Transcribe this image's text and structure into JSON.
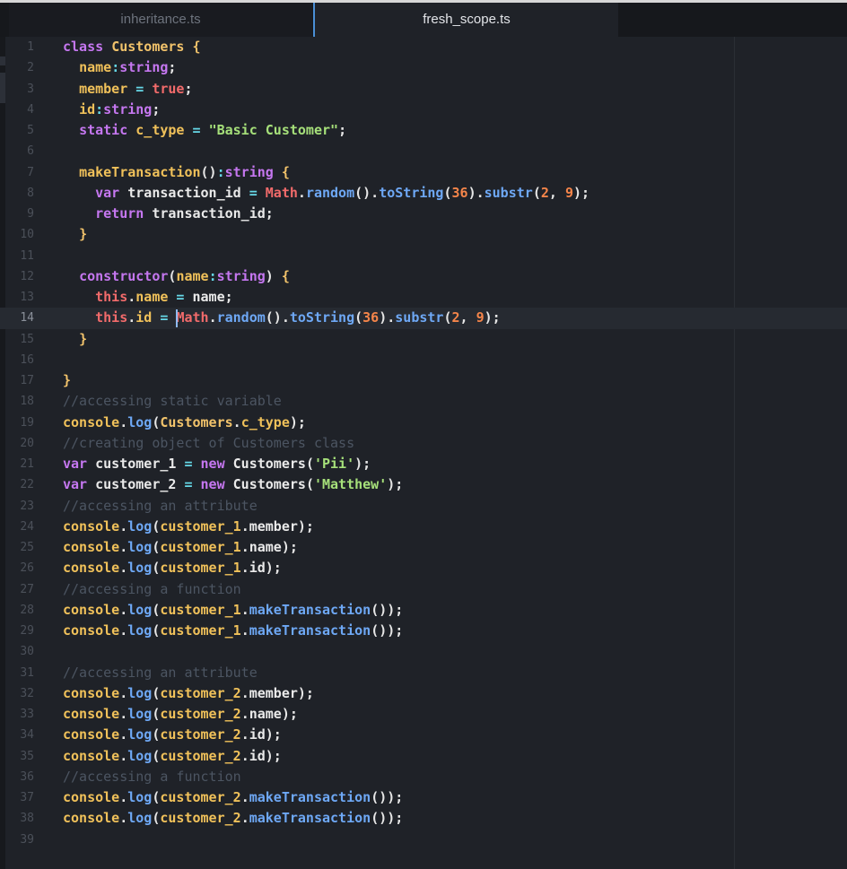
{
  "tabs": [
    {
      "label": "inheritance.ts",
      "active": false
    },
    {
      "label": "fresh_scope.ts",
      "active": true
    }
  ],
  "editor": {
    "current_line": 14,
    "lines": [
      {
        "n": "1",
        "tokens": [
          [
            "kw",
            "class "
          ],
          [
            "cls",
            "Customers "
          ],
          [
            "brace",
            "{"
          ]
        ]
      },
      {
        "n": "2",
        "tokens": [
          [
            "p",
            "  "
          ],
          [
            "prop",
            "name"
          ],
          [
            "op",
            ":"
          ],
          [
            "type",
            "string"
          ],
          [
            "p",
            ";"
          ]
        ]
      },
      {
        "n": "3",
        "tokens": [
          [
            "p",
            "  "
          ],
          [
            "prop",
            "member"
          ],
          [
            "op",
            " = "
          ],
          [
            "bool",
            "true"
          ],
          [
            "p",
            ";"
          ]
        ]
      },
      {
        "n": "4",
        "tokens": [
          [
            "p",
            "  "
          ],
          [
            "prop",
            "id"
          ],
          [
            "op",
            ":"
          ],
          [
            "type",
            "string"
          ],
          [
            "p",
            ";"
          ]
        ]
      },
      {
        "n": "5",
        "tokens": [
          [
            "p",
            "  "
          ],
          [
            "kw",
            "static "
          ],
          [
            "prop",
            "c_type"
          ],
          [
            "op",
            " = "
          ],
          [
            "str",
            "\"Basic Customer\""
          ],
          [
            "p",
            ";"
          ]
        ]
      },
      {
        "n": "6",
        "tokens": []
      },
      {
        "n": "7",
        "tokens": [
          [
            "p",
            "  "
          ],
          [
            "prop",
            "makeTransaction"
          ],
          [
            "p",
            "()"
          ],
          [
            "op",
            ":"
          ],
          [
            "type",
            "string"
          ],
          [
            "p",
            " "
          ],
          [
            "brace",
            "{"
          ]
        ]
      },
      {
        "n": "8",
        "tokens": [
          [
            "p",
            "    "
          ],
          [
            "kw",
            "var "
          ],
          [
            "id",
            "transaction_id"
          ],
          [
            "op",
            " = "
          ],
          [
            "this",
            "Math"
          ],
          [
            "p",
            "."
          ],
          [
            "fn",
            "random"
          ],
          [
            "p",
            "()."
          ],
          [
            "fn",
            "toString"
          ],
          [
            "p",
            "("
          ],
          [
            "num",
            "36"
          ],
          [
            "p",
            ")."
          ],
          [
            "fn",
            "substr"
          ],
          [
            "p",
            "("
          ],
          [
            "num",
            "2"
          ],
          [
            "p",
            ", "
          ],
          [
            "num",
            "9"
          ],
          [
            "p",
            ");"
          ]
        ]
      },
      {
        "n": "9",
        "tokens": [
          [
            "p",
            "    "
          ],
          [
            "kw",
            "return "
          ],
          [
            "id",
            "transaction_id"
          ],
          [
            "p",
            ";"
          ]
        ]
      },
      {
        "n": "10",
        "tokens": [
          [
            "p",
            "  "
          ],
          [
            "brace",
            "}"
          ]
        ]
      },
      {
        "n": "11",
        "tokens": []
      },
      {
        "n": "12",
        "tokens": [
          [
            "p",
            "  "
          ],
          [
            "kw",
            "constructor"
          ],
          [
            "p",
            "("
          ],
          [
            "prop",
            "name"
          ],
          [
            "op",
            ":"
          ],
          [
            "type",
            "string"
          ],
          [
            "p",
            ") "
          ],
          [
            "brace",
            "{"
          ]
        ]
      },
      {
        "n": "13",
        "tokens": [
          [
            "p",
            "    "
          ],
          [
            "this",
            "this"
          ],
          [
            "p",
            "."
          ],
          [
            "prop",
            "name"
          ],
          [
            "op",
            " = "
          ],
          [
            "id",
            "name"
          ],
          [
            "p",
            ";"
          ]
        ]
      },
      {
        "n": "14",
        "tokens": [
          [
            "p",
            "    "
          ],
          [
            "this",
            "this"
          ],
          [
            "p",
            "."
          ],
          [
            "prop",
            "id"
          ],
          [
            "op",
            " = "
          ],
          [
            "this",
            "Math"
          ],
          [
            "p",
            "."
          ],
          [
            "fn",
            "random"
          ],
          [
            "p",
            "()."
          ],
          [
            "fn",
            "toString"
          ],
          [
            "p",
            "("
          ],
          [
            "num",
            "36"
          ],
          [
            "p",
            ")."
          ],
          [
            "fn",
            "substr"
          ],
          [
            "p",
            "("
          ],
          [
            "num",
            "2"
          ],
          [
            "p",
            ", "
          ],
          [
            "num",
            "9"
          ],
          [
            "p",
            ");"
          ]
        ]
      },
      {
        "n": "15",
        "tokens": [
          [
            "p",
            "  "
          ],
          [
            "brace",
            "}"
          ]
        ]
      },
      {
        "n": "16",
        "tokens": []
      },
      {
        "n": "17",
        "tokens": [
          [
            "brace",
            "}"
          ]
        ]
      },
      {
        "n": "18",
        "tokens": [
          [
            "cm",
            "//accessing static variable"
          ]
        ]
      },
      {
        "n": "19",
        "tokens": [
          [
            "prop",
            "console"
          ],
          [
            "p",
            "."
          ],
          [
            "fn",
            "log"
          ],
          [
            "p",
            "("
          ],
          [
            "cls",
            "Customers"
          ],
          [
            "p",
            "."
          ],
          [
            "prop",
            "c_type"
          ],
          [
            "p",
            ");"
          ]
        ]
      },
      {
        "n": "20",
        "tokens": [
          [
            "cm",
            "//creating object of Customers class"
          ]
        ]
      },
      {
        "n": "21",
        "tokens": [
          [
            "kw",
            "var "
          ],
          [
            "id",
            "customer_1"
          ],
          [
            "op",
            " = "
          ],
          [
            "kw",
            "new "
          ],
          [
            "id",
            "Customers"
          ],
          [
            "p",
            "("
          ],
          [
            "str",
            "'Pii'"
          ],
          [
            "p",
            ");"
          ]
        ]
      },
      {
        "n": "22",
        "tokens": [
          [
            "kw",
            "var "
          ],
          [
            "id",
            "customer_2"
          ],
          [
            "op",
            " = "
          ],
          [
            "kw",
            "new "
          ],
          [
            "id",
            "Customers"
          ],
          [
            "p",
            "("
          ],
          [
            "str",
            "'Matthew'"
          ],
          [
            "p",
            ");"
          ]
        ]
      },
      {
        "n": "23",
        "tokens": [
          [
            "cm",
            "//accessing an attribute"
          ]
        ]
      },
      {
        "n": "24",
        "tokens": [
          [
            "prop",
            "console"
          ],
          [
            "p",
            "."
          ],
          [
            "fn",
            "log"
          ],
          [
            "p",
            "("
          ],
          [
            "prop",
            "customer_1"
          ],
          [
            "p",
            "."
          ],
          [
            "id",
            "member"
          ],
          [
            "p",
            ");"
          ]
        ]
      },
      {
        "n": "25",
        "tokens": [
          [
            "prop",
            "console"
          ],
          [
            "p",
            "."
          ],
          [
            "fn",
            "log"
          ],
          [
            "p",
            "("
          ],
          [
            "prop",
            "customer_1"
          ],
          [
            "p",
            "."
          ],
          [
            "id",
            "name"
          ],
          [
            "p",
            ");"
          ]
        ]
      },
      {
        "n": "26",
        "tokens": [
          [
            "prop",
            "console"
          ],
          [
            "p",
            "."
          ],
          [
            "fn",
            "log"
          ],
          [
            "p",
            "("
          ],
          [
            "prop",
            "customer_1"
          ],
          [
            "p",
            "."
          ],
          [
            "id",
            "id"
          ],
          [
            "p",
            ");"
          ]
        ]
      },
      {
        "n": "27",
        "tokens": [
          [
            "cm",
            "//accessing a function"
          ]
        ]
      },
      {
        "n": "28",
        "tokens": [
          [
            "prop",
            "console"
          ],
          [
            "p",
            "."
          ],
          [
            "fn",
            "log"
          ],
          [
            "p",
            "("
          ],
          [
            "prop",
            "customer_1"
          ],
          [
            "p",
            "."
          ],
          [
            "fn",
            "makeTransaction"
          ],
          [
            "p",
            "());"
          ]
        ]
      },
      {
        "n": "29",
        "tokens": [
          [
            "prop",
            "console"
          ],
          [
            "p",
            "."
          ],
          [
            "fn",
            "log"
          ],
          [
            "p",
            "("
          ],
          [
            "prop",
            "customer_1"
          ],
          [
            "p",
            "."
          ],
          [
            "fn",
            "makeTransaction"
          ],
          [
            "p",
            "());"
          ]
        ]
      },
      {
        "n": "30",
        "tokens": []
      },
      {
        "n": "31",
        "tokens": [
          [
            "cm",
            "//accessing an attribute"
          ]
        ]
      },
      {
        "n": "32",
        "tokens": [
          [
            "prop",
            "console"
          ],
          [
            "p",
            "."
          ],
          [
            "fn",
            "log"
          ],
          [
            "p",
            "("
          ],
          [
            "prop",
            "customer_2"
          ],
          [
            "p",
            "."
          ],
          [
            "id",
            "member"
          ],
          [
            "p",
            ");"
          ]
        ]
      },
      {
        "n": "33",
        "tokens": [
          [
            "prop",
            "console"
          ],
          [
            "p",
            "."
          ],
          [
            "fn",
            "log"
          ],
          [
            "p",
            "("
          ],
          [
            "prop",
            "customer_2"
          ],
          [
            "p",
            "."
          ],
          [
            "id",
            "name"
          ],
          [
            "p",
            ");"
          ]
        ]
      },
      {
        "n": "34",
        "tokens": [
          [
            "prop",
            "console"
          ],
          [
            "p",
            "."
          ],
          [
            "fn",
            "log"
          ],
          [
            "p",
            "("
          ],
          [
            "prop",
            "customer_2"
          ],
          [
            "p",
            "."
          ],
          [
            "id",
            "id"
          ],
          [
            "p",
            ");"
          ]
        ]
      },
      {
        "n": "35",
        "tokens": [
          [
            "prop",
            "console"
          ],
          [
            "p",
            "."
          ],
          [
            "fn",
            "log"
          ],
          [
            "p",
            "("
          ],
          [
            "prop",
            "customer_2"
          ],
          [
            "p",
            "."
          ],
          [
            "id",
            "id"
          ],
          [
            "p",
            ");"
          ]
        ]
      },
      {
        "n": "36",
        "tokens": [
          [
            "cm",
            "//accessing a function"
          ]
        ]
      },
      {
        "n": "37",
        "tokens": [
          [
            "prop",
            "console"
          ],
          [
            "p",
            "."
          ],
          [
            "fn",
            "log"
          ],
          [
            "p",
            "("
          ],
          [
            "prop",
            "customer_2"
          ],
          [
            "p",
            "."
          ],
          [
            "fn",
            "makeTransaction"
          ],
          [
            "p",
            "());"
          ]
        ]
      },
      {
        "n": "38",
        "tokens": [
          [
            "prop",
            "console"
          ],
          [
            "p",
            "."
          ],
          [
            "fn",
            "log"
          ],
          [
            "p",
            "("
          ],
          [
            "prop",
            "customer_2"
          ],
          [
            "p",
            "."
          ],
          [
            "fn",
            "makeTransaction"
          ],
          [
            "p",
            "());"
          ]
        ]
      },
      {
        "n": "39",
        "tokens": []
      }
    ]
  }
}
